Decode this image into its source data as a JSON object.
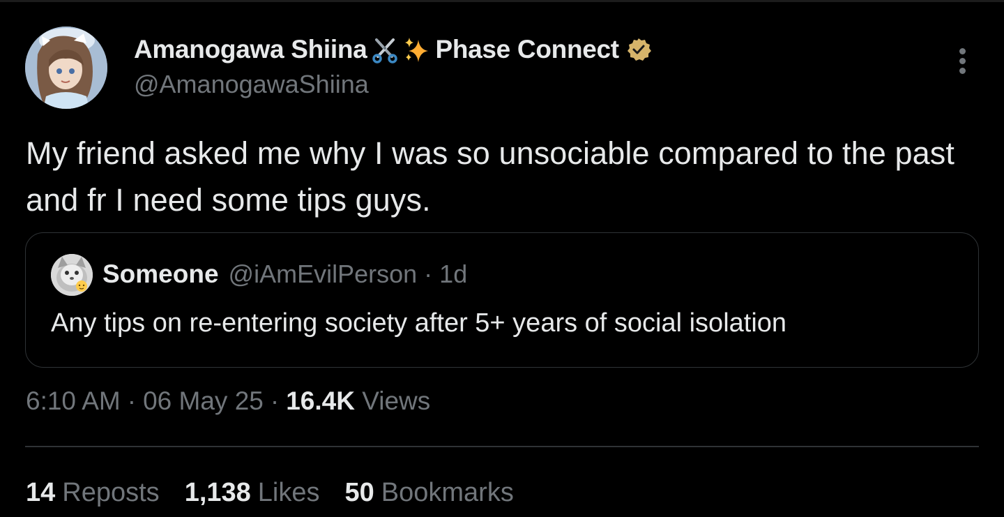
{
  "tweet": {
    "author": {
      "display_name": "Amanogawa Shiina",
      "emoji_1": "scissors-icon",
      "emoji_2": "sparkles-icon",
      "affiliation": "Phase Connect",
      "handle": "@AmanogawaShiina",
      "verified_badge_color": "#d6b46a"
    },
    "text": "My friend asked me why I was so unsociable compared to the past and fr I need some tips guys.",
    "quoted": {
      "display_name": "Someone",
      "handle": "@iAmEvilPerson",
      "separator": "·",
      "time": "1d",
      "text": "Any tips on re-entering society after 5+ years of social isolation"
    },
    "meta": {
      "time": "6:10 AM",
      "separator_1": "·",
      "date": "06 May 25",
      "separator_2": "·",
      "views_count": "16.4K",
      "views_label": "Views"
    },
    "stats": {
      "reposts_count": "14",
      "reposts_label": "Reposts",
      "likes_count": "1,138",
      "likes_label": "Likes",
      "bookmarks_count": "50",
      "bookmarks_label": "Bookmarks"
    }
  },
  "colors": {
    "background": "#000000",
    "primary_text": "#e7e9ea",
    "secondary_text": "#71767b",
    "border": "#2f3336"
  }
}
